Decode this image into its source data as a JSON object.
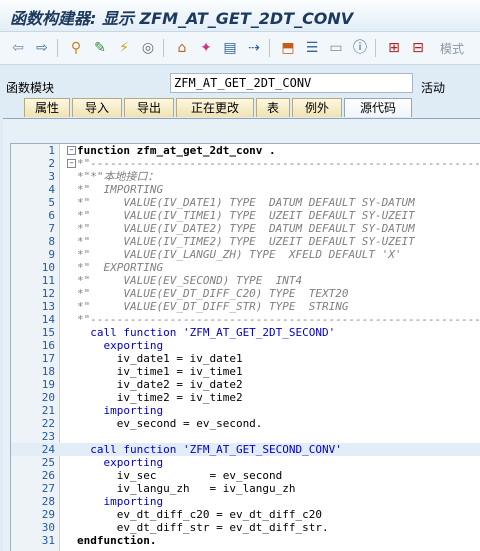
{
  "window": {
    "title": "函数构建器: 显示 ZFM_AT_GET_2DT_CONV"
  },
  "toolbar": {
    "icons": [
      "back-arrow",
      "forward-arrow",
      "other-object",
      "display-change",
      "activate",
      "where-used",
      "object-list",
      "display-object",
      "check",
      "test",
      "insert",
      "pattern",
      "pretty-printer",
      "info",
      "enhance",
      "stop"
    ],
    "mode_label": "模式"
  },
  "function_module": {
    "label": "函数模块",
    "name": "ZFM_AT_GET_2DT_CONV",
    "status": "活动"
  },
  "tabs": [
    {
      "label": "属性",
      "active": false
    },
    {
      "label": "导入",
      "active": false
    },
    {
      "label": "导出",
      "active": false
    },
    {
      "label": "正在更改",
      "active": false
    },
    {
      "label": "表",
      "active": false
    },
    {
      "label": "例外",
      "active": false
    },
    {
      "label": "源代码",
      "active": true
    }
  ],
  "code": {
    "lines": [
      {
        "n": "1",
        "text": "function zfm_at_get_2dt_conv ."
      },
      {
        "n": "2",
        "text": "*\"----------------------------------------------------------------------"
      },
      {
        "n": "3",
        "text": "*\"*\"本地接口："
      },
      {
        "n": "4",
        "text": "*\"  IMPORTING"
      },
      {
        "n": "5",
        "text": "*\"     VALUE(IV_DATE1) TYPE  DATUM DEFAULT SY-DATUM"
      },
      {
        "n": "6",
        "text": "*\"     VALUE(IV_TIME1) TYPE  UZEIT DEFAULT SY-UZEIT"
      },
      {
        "n": "7",
        "text": "*\"     VALUE(IV_DATE2) TYPE  DATUM DEFAULT SY-DATUM"
      },
      {
        "n": "8",
        "text": "*\"     VALUE(IV_TIME2) TYPE  UZEIT DEFAULT SY-UZEIT"
      },
      {
        "n": "9",
        "text": "*\"     VALUE(IV_LANGU_ZH) TYPE  XFELD DEFAULT 'X'"
      },
      {
        "n": "10",
        "text": "*\"  EXPORTING"
      },
      {
        "n": "11",
        "text": "*\"     VALUE(EV_SECOND) TYPE  INT4"
      },
      {
        "n": "12",
        "text": "*\"     VALUE(EV_DT_DIFF_C20) TYPE  TEXT20"
      },
      {
        "n": "13",
        "text": "*\"     VALUE(EV_DT_DIFF_STR) TYPE  STRING"
      },
      {
        "n": "14",
        "text": "*\"----------------------------------------------------------------------"
      },
      {
        "n": "15",
        "text": "  call function 'ZFM_AT_GET_2DT_SECOND'"
      },
      {
        "n": "16",
        "text": "    exporting"
      },
      {
        "n": "17",
        "text": "      iv_date1 = iv_date1"
      },
      {
        "n": "18",
        "text": "      iv_time1 = iv_time1"
      },
      {
        "n": "19",
        "text": "      iv_date2 = iv_date2"
      },
      {
        "n": "20",
        "text": "      iv_time2 = iv_time2"
      },
      {
        "n": "21",
        "text": "    importing"
      },
      {
        "n": "22",
        "text": "      ev_second = ev_second."
      },
      {
        "n": "23",
        "text": ""
      },
      {
        "n": "24",
        "text": "  call function 'ZFM_AT_GET_SECOND_CONV'"
      },
      {
        "n": "25",
        "text": "    exporting"
      },
      {
        "n": "26",
        "text": "      iv_sec        = ev_second"
      },
      {
        "n": "27",
        "text": "      iv_langu_zh   = iv_langu_zh"
      },
      {
        "n": "28",
        "text": "    importing"
      },
      {
        "n": "29",
        "text": "      ev_dt_diff_c20 = ev_dt_diff_c20"
      },
      {
        "n": "30",
        "text": "      ev_dt_diff_str = ev_dt_diff_str."
      },
      {
        "n": "31",
        "text": "endfunction."
      }
    ]
  }
}
